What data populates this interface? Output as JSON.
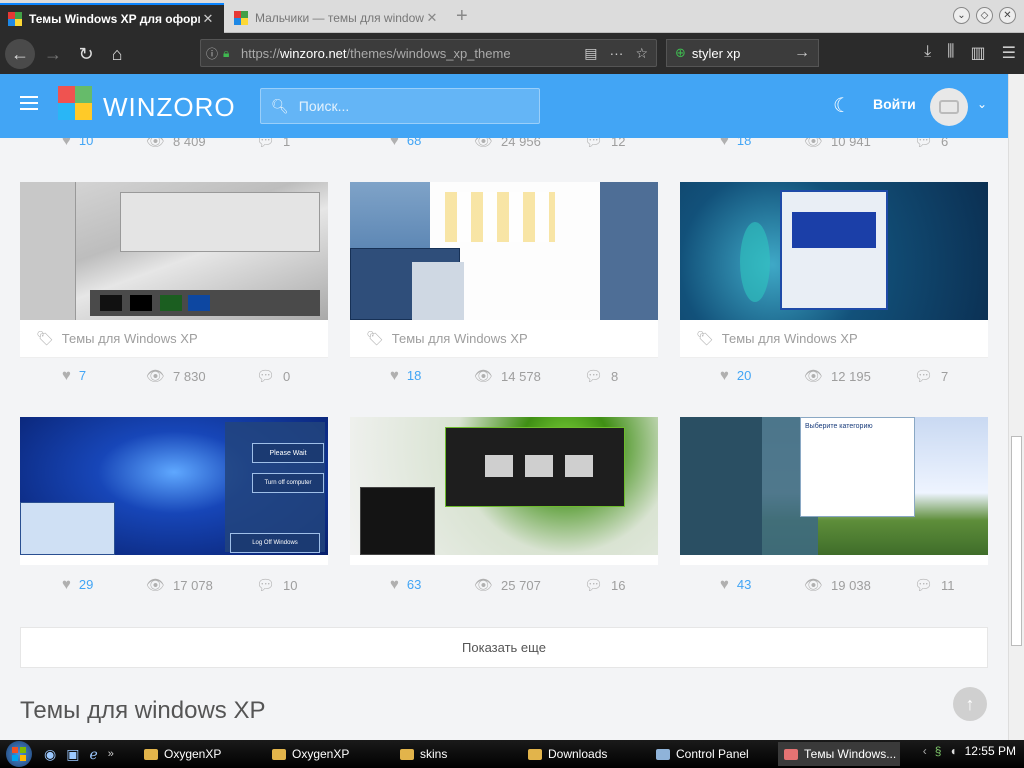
{
  "browser": {
    "active_tab_title": "Темы Windows XP для оформлен",
    "inactive_tab_title": "Мальчики — темы для windows XP",
    "url_prefix": "https://",
    "url_domain": "winzoro.net",
    "url_path": "/themes/windows_xp_theme",
    "search_value": "styler xp"
  },
  "site": {
    "brand": "WINZORO",
    "search_placeholder": "Поиск...",
    "login_label": "Войти",
    "accent_color": "#42a5f5"
  },
  "top_stats": [
    {
      "likes": "10",
      "views": "8 409",
      "comments": "1"
    },
    {
      "likes": "68",
      "views": "24 956",
      "comments": "12"
    },
    {
      "likes": "18",
      "views": "10 941",
      "comments": "6"
    }
  ],
  "row1": [
    {
      "tag": "Темы для Windows XP",
      "likes": "7",
      "views": "7 830",
      "comments": "0"
    },
    {
      "tag": "Темы для Windows XP",
      "likes": "18",
      "views": "14 578",
      "comments": "8"
    },
    {
      "tag": "Темы для Windows XP",
      "likes": "20",
      "views": "12 195",
      "comments": "7"
    }
  ],
  "row2": [
    {
      "likes": "29",
      "views": "17 078",
      "comments": "10"
    },
    {
      "likes": "63",
      "views": "25 707",
      "comments": "16"
    },
    {
      "likes": "43",
      "views": "19 038",
      "comments": "11"
    }
  ],
  "show_more": "Показать еще",
  "section_title": "Темы для windows XP",
  "thumb_texts": {
    "please_wait": "Please Wait",
    "turn_off": "Turn off computer",
    "log_off": "Log Off Windows",
    "choose_category": "Выберите категорию"
  },
  "taskbar": {
    "tasks": [
      "OxygenXP",
      "OxygenXP",
      "skins",
      "Downloads",
      "Control Panel",
      "Темы Windows..."
    ],
    "clock": "12:55 PM"
  }
}
